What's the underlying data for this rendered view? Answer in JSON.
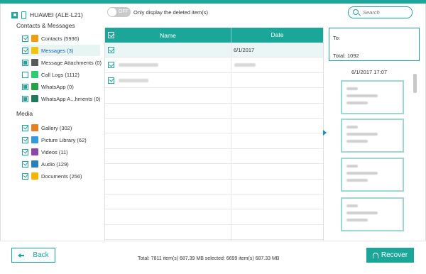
{
  "device": {
    "name": "HUAWEI (ALE-L21)"
  },
  "sidebar": {
    "sections": [
      {
        "title": "Contacts & Messages",
        "items": [
          {
            "label": "Contacts (5936)",
            "icon": "contacts-icon",
            "color": "#f39c12",
            "state": "checked",
            "selected": false
          },
          {
            "label": "Messages (3)",
            "icon": "messages-icon",
            "color": "#f1c40f",
            "state": "checked",
            "selected": true
          },
          {
            "label": "Message Attachments (0)",
            "icon": "attachments-icon",
            "color": "#5a5a5a",
            "state": "partial",
            "selected": false
          },
          {
            "label": "Call Logs (1112)",
            "icon": "call-logs-icon",
            "color": "#2ecc71",
            "state": "unchecked",
            "selected": false
          },
          {
            "label": "WhatsApp (0)",
            "icon": "whatsapp-icon",
            "color": "#25a244",
            "state": "partial",
            "selected": false
          },
          {
            "label": "WhatsApp A...hments (0)",
            "icon": "whatsapp-attachments-icon",
            "color": "#1f7a5a",
            "state": "partial",
            "selected": false
          }
        ]
      },
      {
        "title": "Media",
        "items": [
          {
            "label": "Gallery (302)",
            "icon": "gallery-icon",
            "color": "#e67e22",
            "state": "checked",
            "selected": false
          },
          {
            "label": "Picture Library (62)",
            "icon": "picture-library-icon",
            "color": "#3498db",
            "state": "checked",
            "selected": false
          },
          {
            "label": "Videos (11)",
            "icon": "videos-icon",
            "color": "#8e44ad",
            "state": "checked",
            "selected": false
          },
          {
            "label": "Audio (129)",
            "icon": "audio-icon",
            "color": "#2980b9",
            "state": "checked",
            "selected": false
          },
          {
            "label": "Documents (256)",
            "icon": "documents-icon",
            "color": "#f5b400",
            "state": "checked",
            "selected": false
          }
        ]
      }
    ]
  },
  "toggle": {
    "state": "OFF",
    "label": "Only display the deleted item(s)"
  },
  "search": {
    "placeholder": "Search"
  },
  "table": {
    "columns": [
      "Name",
      "Date"
    ],
    "rows": [
      {
        "name": "",
        "date": "6/1/2017",
        "checked": true,
        "selected": true
      },
      {
        "name": "",
        "date": "",
        "checked": true,
        "selected": false
      },
      {
        "name": "",
        "date": "",
        "checked": true,
        "selected": false
      }
    ],
    "empty_rows": 11
  },
  "preview": {
    "to_label": "To:",
    "total_label": "Total: 1092",
    "date": "6/1/2017 17:07",
    "bubble_count": 4
  },
  "footer": {
    "back_label": "Back",
    "status": "Total: 7811 item(s) 687.39 MB   selected: 6699 item(s) 687.33 MB",
    "recover_label": "Recover"
  },
  "colors": {
    "accent": "#1aa79a",
    "selected_link": "#1a5fb4"
  }
}
